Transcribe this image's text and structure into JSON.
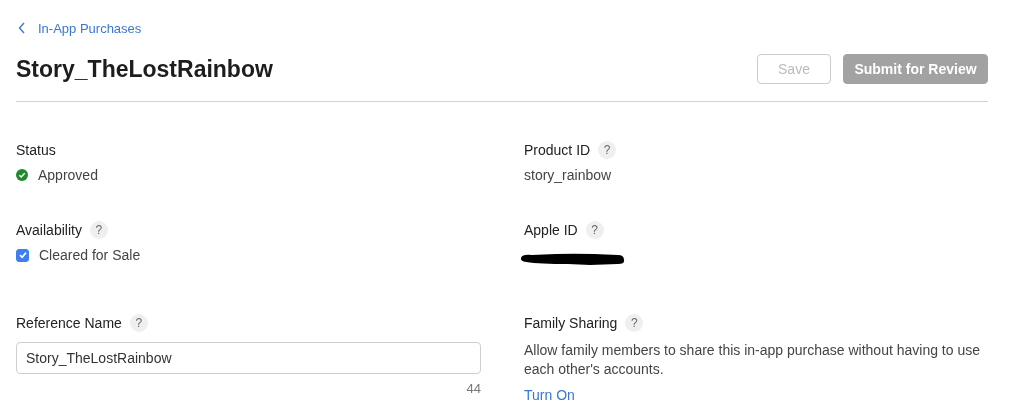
{
  "breadcrumb": {
    "label": "In-App Purchases"
  },
  "title": "Story_TheLostRainbow",
  "buttons": [
    {
      "label": "Save",
      "kind": "outline",
      "disabled": true
    },
    {
      "label": "Submit for Review",
      "kind": "filled",
      "disabled": true
    }
  ],
  "left_fields": [
    {
      "label": "Status",
      "kind": "status",
      "value": "Approved",
      "color": "#1f8a2e"
    },
    {
      "label": "Availability",
      "help": "?",
      "kind": "checkbox",
      "value": "Cleared for Sale",
      "checked": true
    },
    {
      "label": "Reference Name",
      "help": "?",
      "kind": "input",
      "value": "Story_TheLostRainbow",
      "count": "44"
    }
  ],
  "right_fields": [
    {
      "label": "Product ID",
      "help": "?",
      "kind": "text",
      "value": "story_rainbow"
    },
    {
      "label": "Apple ID",
      "help": "?",
      "kind": "redacted"
    },
    {
      "label": "Family Sharing",
      "help": "?",
      "kind": "description",
      "value": "Allow family members to share this in-app purchase without having to use each other's accounts.",
      "link": "Turn On"
    }
  ]
}
